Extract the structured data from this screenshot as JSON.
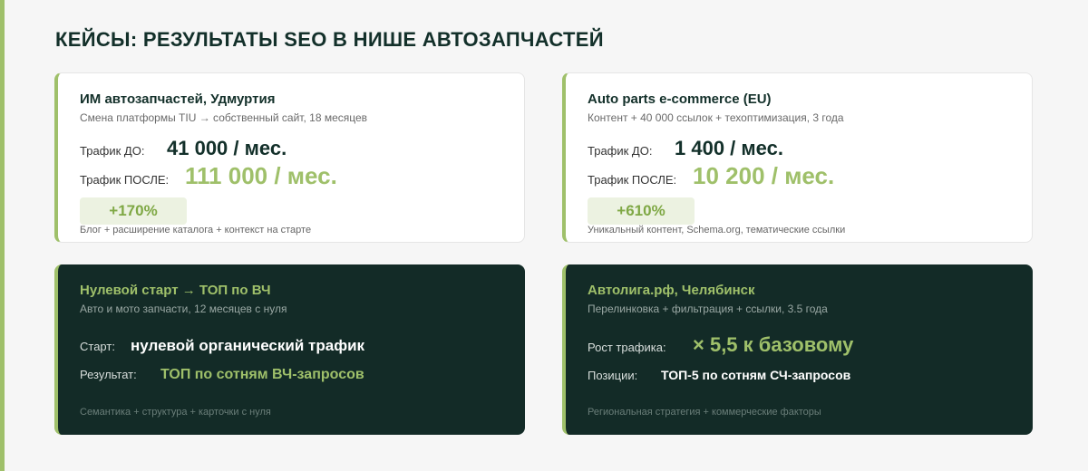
{
  "page": {
    "title": "КЕЙСЫ: РЕЗУЛЬТАТЫ SEO В НИШЕ АВТОЗАПЧАСТЕЙ"
  },
  "colors": {
    "accent": "#9fc06a",
    "dark": "#132b27",
    "text": "#13302a"
  },
  "cases": [
    {
      "title": "ИМ автозапчастей, Удмуртия",
      "subtitle": "Смена платформы TIU → собственный сайт, 18 месяцев",
      "before_label": "Трафик ДО:",
      "before_value": "41 000 / мес.",
      "after_label": "Трафик ПОСЛЕ:",
      "after_value": "111 000 / мес.",
      "badge": "+170%",
      "footnote": "Блог + расширение каталога + контекст на старте"
    },
    {
      "title": "Auto parts e-commerce (EU)",
      "subtitle": "Контент + 40 000 ссылок + техоптимизация, 3 года",
      "before_label": "Трафик ДО:",
      "before_value": "1 400 / мес.",
      "after_label": "Трафик ПОСЛЕ:",
      "after_value": "10 200 / мес.",
      "badge": "+610%",
      "footnote": "Уникальный контент, Schema.org, тематические ссылки"
    },
    {
      "title": "Нулевой старт → ТОП по ВЧ",
      "subtitle": "Авто и мото запчасти, 12 месяцев с нуля",
      "row1_label": "Старт:",
      "row1_value": "нулевой органический трафик",
      "row2_label": "Результат:",
      "row2_value": "ТОП по сотням ВЧ-запросов",
      "footnote": "Семантика + структура + карточки с нуля"
    },
    {
      "title": "Автолига.рф, Челябинск",
      "subtitle": "Перелинковка + фильтрация + ссылки, 3.5 года",
      "row1_label": "Рост трафика:",
      "row1_value": "× 5,5 к базовому",
      "row2_label": "Позиции:",
      "row2_value": "ТОП-5 по сотням СЧ-запросов",
      "footnote": "Региональная стратегия + коммерческие факторы"
    }
  ]
}
